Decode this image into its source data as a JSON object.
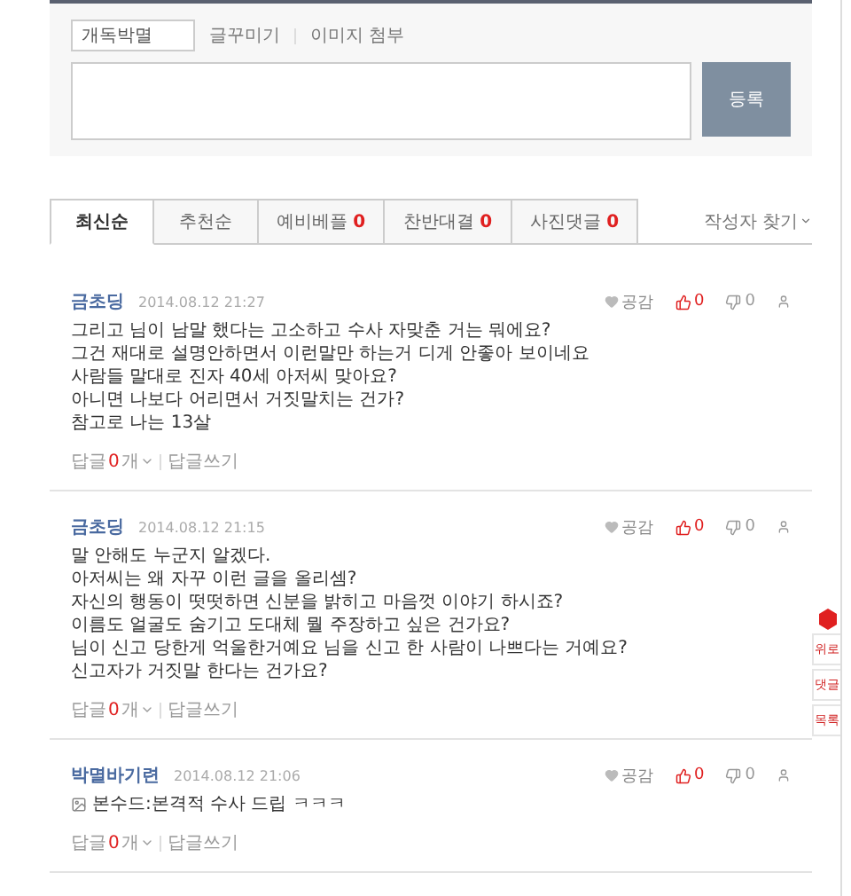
{
  "comment_form": {
    "name_value": "개독박멸",
    "toolbar_links": [
      "글꾸미기",
      "이미지 첨부"
    ],
    "submit_label": "등록"
  },
  "tabs": [
    {
      "label": "최신순",
      "selected": true
    },
    {
      "label": "추천순",
      "selected": false
    },
    {
      "label": "예비베플",
      "count": "0",
      "selected": false
    },
    {
      "label": "찬반대결",
      "count": "0",
      "selected": false
    },
    {
      "label": "사진댓글",
      "count": "0",
      "selected": false
    }
  ],
  "author_search": "작성자 찾기",
  "comments": [
    {
      "author": "금초딩",
      "time": "2014.08.12 21:27",
      "empathy": "공감",
      "likes": "0",
      "dislikes": "0",
      "has_icon": false,
      "lines": [
        "그리고 님이 남말 했다는 고소하고 수사 자맞춘 거는 뭐에요?",
        "그건 재대로 설명안하면서 이런말만 하는거 디게 안좋아 보이네요",
        "사람들 말대로 진자 40세 아저씨 맞아요?",
        "아니면 나보다 어리면서 거짓말치는 건가?",
        "참고로 나는 13살"
      ],
      "reply_label": "답글",
      "reply_count": "0",
      "reply_unit": "개",
      "write_reply": "답글쓰기"
    },
    {
      "author": "금초딩",
      "time": "2014.08.12 21:15",
      "empathy": "공감",
      "likes": "0",
      "dislikes": "0",
      "has_icon": false,
      "lines": [
        "말 안해도 누군지 알겠다.",
        "아저씨는 왜 자꾸 이런 글을 올리셈?",
        "자신의 행동이 떳떳하면 신분을 밝히고 마음껏 이야기 하시죠?",
        "이름도 얼굴도 숨기고 도대체 뭘 주장하고 싶은 건가요?",
        "님이 신고 당한게 억울한거예요 님을 신고 한 사람이 나쁘다는 거예요?",
        "신고자가 거짓말 한다는 건가요?"
      ],
      "reply_label": "답글",
      "reply_count": "0",
      "reply_unit": "개",
      "write_reply": "답글쓰기"
    },
    {
      "author": "박멸바기련",
      "time": "2014.08.12 21:06",
      "empathy": "공감",
      "likes": "0",
      "dislikes": "0",
      "has_icon": true,
      "lines": [
        "본수드:본격적 수사 드립 ㅋㅋㅋ"
      ],
      "reply_label": "답글",
      "reply_count": "0",
      "reply_unit": "개",
      "write_reply": "답글쓰기"
    }
  ],
  "side_buttons": [
    {
      "kind": "icon"
    },
    {
      "kind": "text",
      "label": "위로"
    },
    {
      "kind": "text",
      "label": "댓글"
    },
    {
      "kind": "text",
      "label": "목록"
    }
  ]
}
